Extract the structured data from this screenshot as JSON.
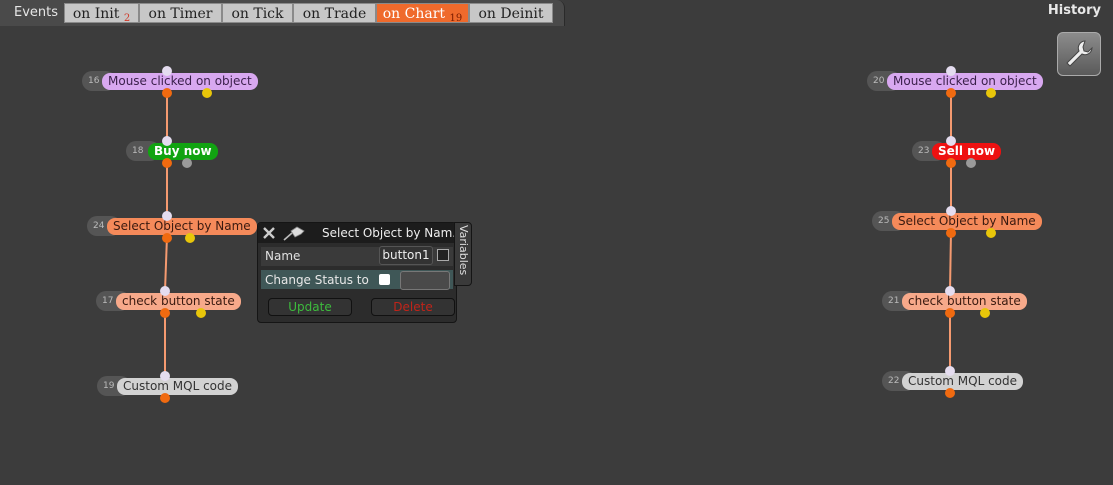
{
  "header": {
    "events_label": "Events",
    "history_label": "History",
    "tabs": [
      {
        "label": "on Init",
        "count": "2"
      },
      {
        "label": "on Timer",
        "count": ""
      },
      {
        "label": "on Tick",
        "count": ""
      },
      {
        "label": "on Trade",
        "count": ""
      },
      {
        "label": "on Chart",
        "count": "19"
      },
      {
        "label": "on Deinit",
        "count": ""
      }
    ],
    "active_tab": "on Chart"
  },
  "nodes": {
    "n16": {
      "id": "16",
      "label": "Mouse clicked on object"
    },
    "n18": {
      "id": "18",
      "label": "Buy now"
    },
    "n24": {
      "id": "24",
      "label": "Select Object by Name"
    },
    "n17": {
      "id": "17",
      "label": "check button state"
    },
    "n19": {
      "id": "19",
      "label": "Custom MQL code"
    },
    "n20": {
      "id": "20",
      "label": "Mouse clicked on object"
    },
    "n23": {
      "id": "23",
      "label": "Sell now"
    },
    "n25": {
      "id": "25",
      "label": "Select Object by Name"
    },
    "n21": {
      "id": "21",
      "label": "check button state"
    },
    "n22": {
      "id": "22",
      "label": "Custom MQL code"
    }
  },
  "popup": {
    "title": "Select Object by Nam...",
    "name_label": "Name",
    "name_value": "button1",
    "status_label": "Change Status to",
    "update_label": "Update",
    "delete_label": "Delete",
    "variables_label": "Variables"
  },
  "colors": {
    "node_purple": "#d8a8f0",
    "node_orange": "#f58a5a",
    "node_salmon": "#f7a98a",
    "node_grey": "#d2d2d2",
    "node_buy": "#11a311",
    "node_sell": "#ee1111",
    "active_tab": "#ef6a2c",
    "link": "#f59a70"
  },
  "icons": [
    "wrench-icon",
    "close-icon",
    "pin-icon"
  ]
}
